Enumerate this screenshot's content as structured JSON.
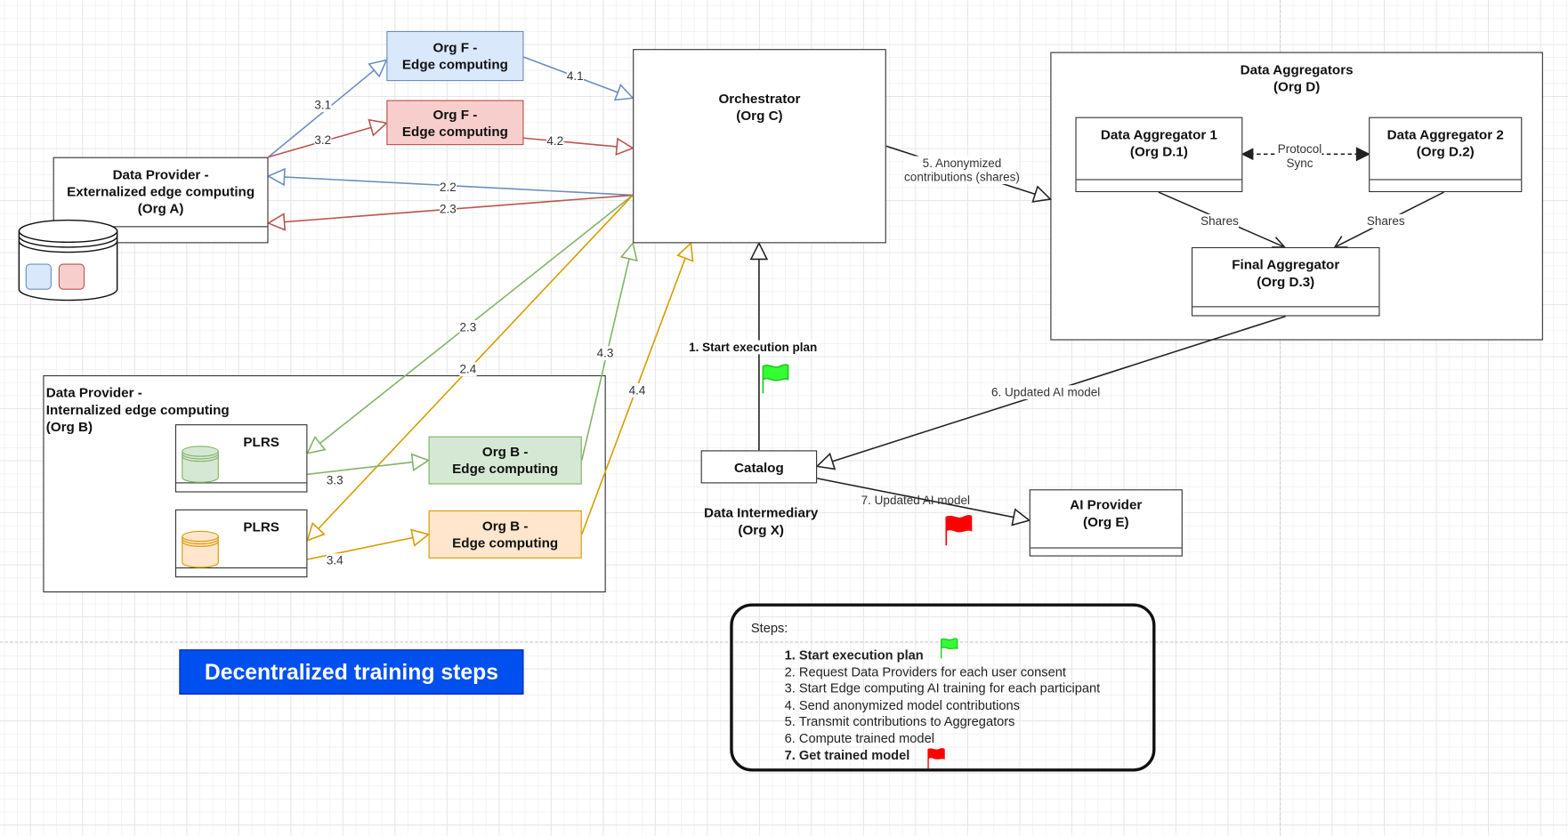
{
  "title_banner": "Decentralized training steps",
  "colors": {
    "blue_stroke": "#6c8ebf",
    "blue_fill": "#dae8fc",
    "red_stroke": "#b85450",
    "red_fill": "#f8cecc",
    "green_stroke": "#82b366",
    "green_fill": "#d5e8d4",
    "orange_stroke": "#d79b00",
    "orange_fill": "#ffe6cc",
    "banner": "#0050ef",
    "flag_start": "#33ff33",
    "flag_end": "#ff0000"
  },
  "nodes": {
    "org_f_blue": "Org F -\nEdge computing",
    "org_f_red": "Org F -\nEdge computing",
    "data_provider_a": "Data Provider -\nExternalized edge computing\n(Org A)",
    "orchestrator": "Orchestrator\n(Org C)",
    "data_aggregators": "Data Aggregators\n(Org D)",
    "aggregator_1": "Data Aggregator 1\n(Org D.1)",
    "aggregator_2": "Data Aggregator 2\n(Org D.2)",
    "final_aggregator": "Final Aggregator\n(Org D.3)",
    "data_provider_b": "Data Provider -\nInternalized edge computing\n(Org B)",
    "plrs_1": "PLRS",
    "plrs_2": "PLRS",
    "org_b_green": "Org B -\nEdge computing",
    "org_b_orange": "Org B -\nEdge computing",
    "catalog": "Catalog",
    "data_intermediary": "Data Intermediary\n(Org X)",
    "ai_provider": "AI Provider\n(Org E)"
  },
  "edge_labels": {
    "e31": "3.1",
    "e32": "3.2",
    "e41": "4.1",
    "e42": "4.2",
    "e22": "2.2",
    "e23a": "2.3",
    "e23b": "2.3",
    "e24": "2.4",
    "e33": "3.3",
    "e34": "3.4",
    "e43": "4.3",
    "e44": "4.4",
    "e5": "5. Anonymized\ncontributions (shares)",
    "sync": "Protocol\nSync",
    "shares1": "Shares",
    "shares2": "Shares",
    "e1": "1. Start execution plan",
    "e6": "6. Updated AI model",
    "e7": "7. Updated AI model"
  },
  "steps": {
    "title": "Steps:",
    "items": [
      {
        "text": "Start execution plan",
        "bold": true
      },
      {
        "text": "Request Data Providers for each user consent",
        "bold": false
      },
      {
        "text": "Start Edge computing AI training for each participant",
        "bold": false
      },
      {
        "text": "Send anonymized model contributions",
        "bold": false
      },
      {
        "text": "Transmit contributions to Aggregators",
        "bold": false
      },
      {
        "text": "Compute trained model",
        "bold": false
      },
      {
        "text": "Get trained model",
        "bold": true
      }
    ]
  }
}
